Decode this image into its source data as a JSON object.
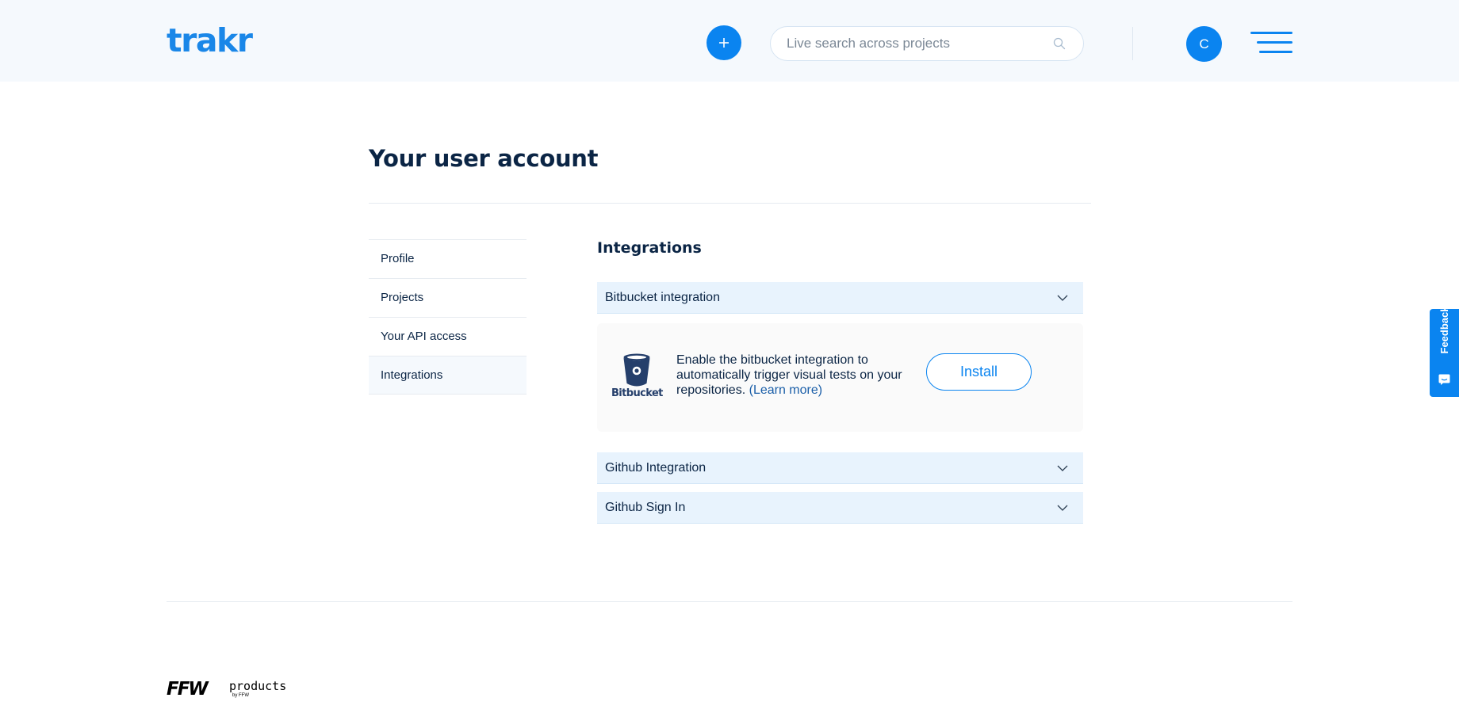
{
  "header": {
    "logo": "trakr",
    "add_icon": "plus-icon",
    "add_label": "+",
    "search_placeholder": "Live search across projects",
    "search_icon": "search-icon",
    "avatar_initial": "C",
    "menu_icon": "hamburger-menu-icon"
  },
  "page": {
    "title": "Your user account"
  },
  "sidebar": {
    "items": [
      {
        "label": "Profile",
        "active": false
      },
      {
        "label": "Projects",
        "active": false
      },
      {
        "label": "Your API access",
        "active": false
      },
      {
        "label": "Integrations",
        "active": true
      }
    ]
  },
  "main": {
    "section_title": "Integrations",
    "accordions": [
      {
        "label": "Bitbucket integration",
        "expanded": true
      },
      {
        "label": "Github Integration",
        "expanded": false
      },
      {
        "label": "Github Sign In",
        "expanded": false
      }
    ],
    "bitbucket_panel": {
      "logo_text": "Bitbucket",
      "description": "Enable the bitbucket integration to automatically trigger visual tests on your repositories.",
      "learn_more": "(Learn more)",
      "install_label": "Install"
    }
  },
  "footer": {
    "brand_logo": "FFW",
    "products_logo": "products",
    "products_by": "by FFW"
  },
  "feedback": {
    "label": "Feedback",
    "icon": "chat-icon"
  },
  "colors": {
    "accent": "#0a84f0",
    "header_bg": "#f5f9fd",
    "accordion_bg": "#e8f3fd",
    "text": "#0b2545"
  }
}
